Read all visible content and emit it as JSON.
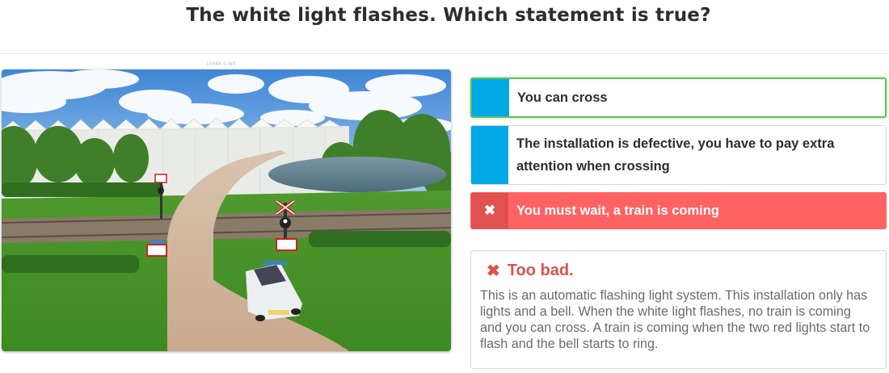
{
  "question": {
    "title": "The white light flashes. Which statement is true?",
    "image_caption": "15964 S.Wit"
  },
  "options": [
    {
      "label": "You can cross",
      "state": "selected-correct"
    },
    {
      "label": "The installation is defective, you have to pay extra attention when crossing",
      "state": "neutral"
    },
    {
      "label": "You must wait, a train is coming",
      "state": "wrong",
      "icon": "close-icon"
    }
  ],
  "feedback": {
    "icon": "close-icon",
    "heading": "Too bad.",
    "text": "This is an automatic flashing light system. This installation only has lights and a bell. When the white light flashes, no train is coming and you can cross. A train is coming when the two red lights start to flash and the bell starts to ring."
  },
  "colors": {
    "accent_blue": "#00a9e6",
    "correct_border": "#5cc25c",
    "wrong_bg": "#ff6262",
    "wrong_text": "#d9534f"
  }
}
